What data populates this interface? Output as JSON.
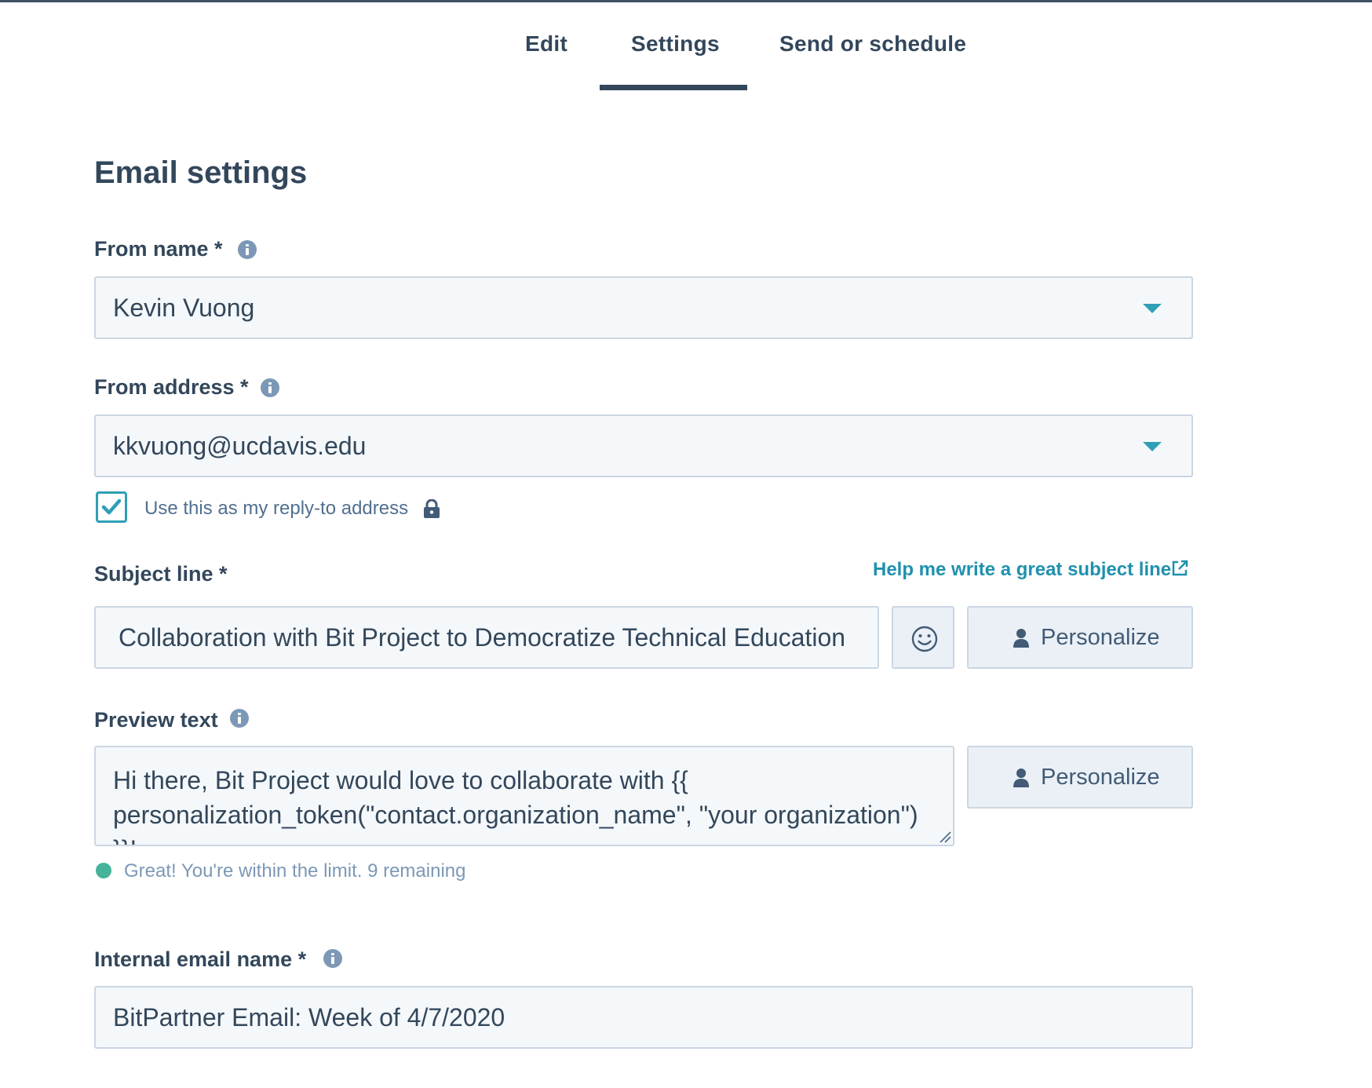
{
  "tabs": [
    {
      "label": "Edit"
    },
    {
      "label": "Settings",
      "active": true
    },
    {
      "label": "Send or schedule"
    }
  ],
  "page_title": "Email settings",
  "from_name": {
    "label": "From name *",
    "value": "Kevin Vuong"
  },
  "from_address": {
    "label": "From address *",
    "value": "kkvuong@ucdavis.edu"
  },
  "reply_to": {
    "label": "Use this as my reply-to address",
    "checked": true
  },
  "subject": {
    "label": "Subject line *",
    "help_link": "Help me write a great subject line",
    "value": "Collaboration with Bit Project to Democratize Technical Education",
    "personalize_label": "Personalize"
  },
  "preview": {
    "label": "Preview text",
    "value": "Hi there, Bit Project would love to collaborate with {{ personalization_token(\"contact.organization_name\", \"your organization\") }}!",
    "personalize_label": "Personalize",
    "limit_message": "Great! You're within the limit. 9 remaining"
  },
  "internal_name": {
    "label": "Internal email name *",
    "value": "BitPartner Email: Week of 4/7/2020"
  },
  "colors": {
    "accent": "#2f9fb6",
    "text": "#33475b",
    "success": "#47b39a"
  }
}
